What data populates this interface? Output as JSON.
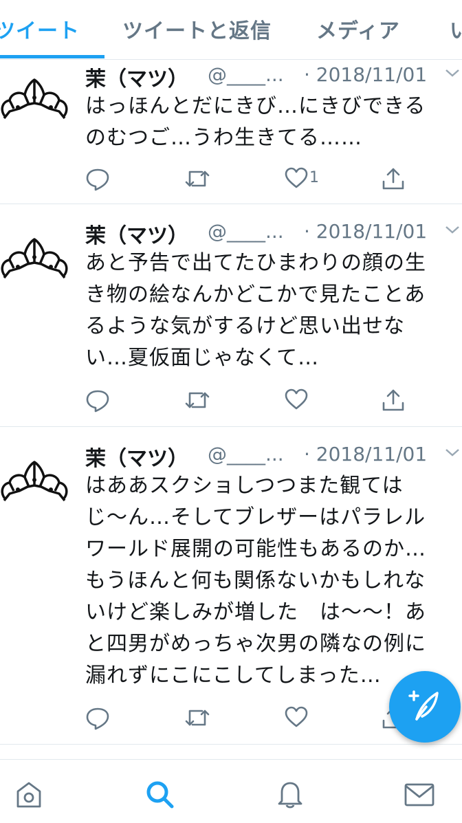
{
  "tabs": [
    {
      "label": "ツイート",
      "active": true
    },
    {
      "label": "ツイートと返信",
      "active": false
    },
    {
      "label": "メディア",
      "active": false
    },
    {
      "label": "い",
      "active": false
    }
  ],
  "tweets": [
    {
      "name": "茉（マツ）",
      "handle": "@____...",
      "date": "· 2018/11/01",
      "text": "はっほんとだにきび…にきびできる\nのむつご…うわ生きてる……",
      "like_count": "1"
    },
    {
      "name": "茉（マツ）",
      "handle": "@____...",
      "date": "· 2018/11/01",
      "text": "あと予告で出てたひまわりの顔の生\nき物の絵なんかどこかで見たことあ\nるような気がするけど思い出せな\nい…夏仮面じゃなくて…",
      "like_count": ""
    },
    {
      "name": "茉（マツ）",
      "handle": "@____...",
      "date": "· 2018/11/01",
      "text": "はああスクショしつつまた観ては\nじ〜ん…そしてブレザーはパラレル\nワールド展開の可能性もあるのか…\nもうほんと何も関係ないかもしれな\nいけど楽しみが増した　は〜〜！あ\nと四男がめっちゃ次男の隣なの例に\n漏れずにこにこしてしまった…",
      "like_count": ""
    }
  ],
  "icons": {
    "reply": "reply-icon",
    "retweet": "retweet-icon",
    "like": "heart-icon",
    "share": "share-icon",
    "compose": "compose-tweet-icon",
    "nav": [
      "home-icon",
      "search-icon",
      "notifications-icon",
      "messages-icon"
    ]
  },
  "colors": {
    "accent": "#1da1f2",
    "muted": "#657786",
    "text": "#14171a",
    "border": "#e1e8ed"
  }
}
